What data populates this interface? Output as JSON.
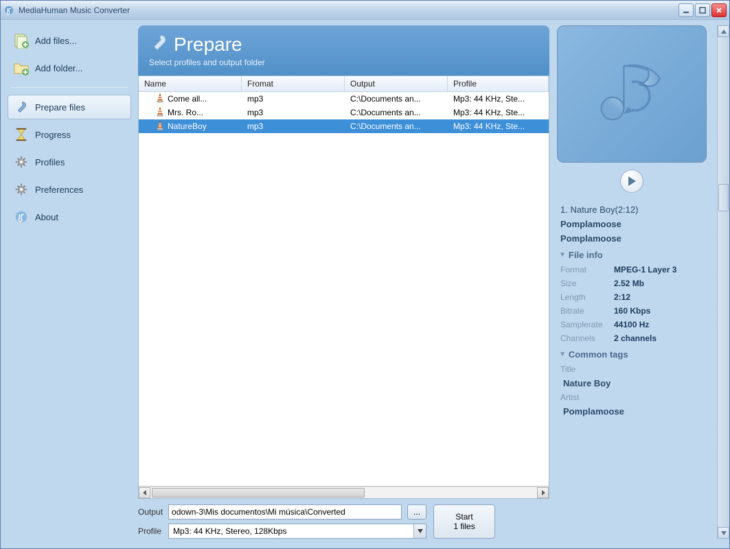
{
  "window": {
    "title": "MediaHuman Music Converter"
  },
  "sidebar": {
    "add_files": "Add files...",
    "add_folder": "Add folder...",
    "items": [
      {
        "label": "Prepare files",
        "selected": true
      },
      {
        "label": "Progress",
        "selected": false
      },
      {
        "label": "Profiles",
        "selected": false
      },
      {
        "label": "Preferences",
        "selected": false
      },
      {
        "label": "About",
        "selected": false
      }
    ]
  },
  "header": {
    "title": "Prepare",
    "subtitle": "Select profiles and output folder"
  },
  "table": {
    "columns": [
      "Name",
      "Fromat",
      "Output",
      "Profile"
    ],
    "rows": [
      {
        "name": "Come all...",
        "format": "mp3",
        "output": "C:\\Documents an...",
        "profile": "Mp3: 44 KHz, Ste...",
        "selected": false
      },
      {
        "name": "Mrs. Ro...",
        "format": "mp3",
        "output": "C:\\Documents an...",
        "profile": "Mp3: 44 KHz, Ste...",
        "selected": false
      },
      {
        "name": "NatureBoy",
        "format": "mp3",
        "output": "C:\\Documents an...",
        "profile": "Mp3: 44 KHz, Ste...",
        "selected": true
      }
    ]
  },
  "output": {
    "label": "Output",
    "value": "odown-3\\Mis documentos\\Mi música\\Converted",
    "browse": "..."
  },
  "profile": {
    "label": "Profile",
    "value": "Mp3: 44 KHz, Stereo, 128Kbps"
  },
  "start": {
    "line1": "Start",
    "line2": "1 files"
  },
  "preview": {
    "track_line": "1. Nature Boy(2:12)",
    "artist1": "Pomplamoose",
    "artist2": "Pomplamoose",
    "file_info_header": "File info",
    "file_info": [
      {
        "k": "Format",
        "v": "MPEG-1 Layer 3"
      },
      {
        "k": "Size",
        "v": "2.52 Mb"
      },
      {
        "k": "Length",
        "v": "2:12"
      },
      {
        "k": "Bitrate",
        "v": "160 Kbps"
      },
      {
        "k": "Samplerate",
        "v": "44100 Hz"
      },
      {
        "k": "Channels",
        "v": "2 channels"
      }
    ],
    "common_tags_header": "Common tags",
    "tags": {
      "title_label": "Title",
      "title_value": "Nature Boy",
      "artist_label": "Artist",
      "artist_value": "Pomplamoose"
    }
  }
}
